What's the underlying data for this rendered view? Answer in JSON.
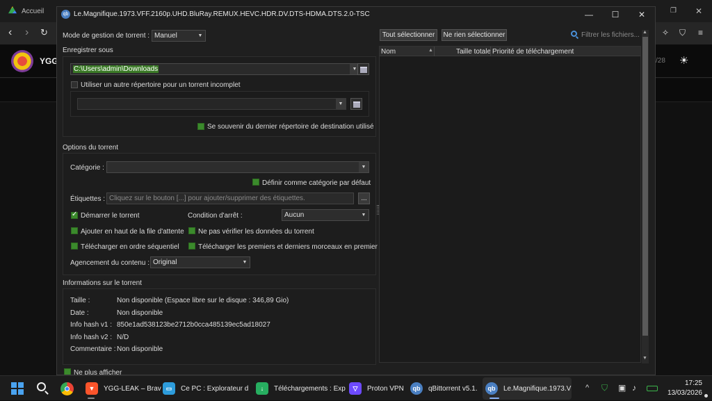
{
  "browser": {
    "tab_title": "Accueil",
    "site_logo_text": "YGG",
    "page_counter": "/28"
  },
  "dialog": {
    "title": "Le.Magnifique.1973.VFF.2160p.UHD.BluRay.REMUX.HEVC.HDR.DV.DTS-HDMA.DTS.2.0-TSC",
    "mode_label": "Mode de gestion de torrent :",
    "mode_value": "Manuel",
    "save_section": "Enregistrer sous",
    "save_path": "C:\\Users\\admin\\Downloads",
    "incomplete_label": "Utiliser un autre répertoire pour un torrent incomplet",
    "remember_label": "Se souvenir du dernier répertoire de destination utilisé",
    "options_section": "Options du torrent",
    "category_label": "Catégorie :",
    "category_value": "",
    "default_category_label": "Définir comme catégorie par défaut",
    "tags_label": "Étiquettes :",
    "tags_placeholder": "Cliquez sur le bouton [...] pour ajouter/supprimer des étiquettes.",
    "tags_button": "...",
    "start_label": "Démarrer le torrent",
    "stop_condition_label": "Condition d'arrêt :",
    "stop_condition_value": "Aucun",
    "add_top_label": "Ajouter en haut de la file d'attente",
    "skip_check_label": "Ne pas vérifier les données du torrent",
    "sequential_label": "Télécharger en ordre séquentiel",
    "first_last_label": "Télécharger les premiers et derniers morceaux en premier",
    "layout_label": "Agencement du contenu :",
    "layout_value": "Original",
    "info_section": "Informations sur le torrent",
    "info": {
      "size_label": "Taille :",
      "size_value": "Non disponible (Espace libre sur le disque : 346,89 Gio)",
      "date_label": "Date :",
      "date_value": "Non disponible",
      "hash1_label": "Info hash v1 :",
      "hash1_value": "850e1ad538123be2712b0cca485139ec5ad18027",
      "hash2_label": "Info hash v2 :",
      "hash2_value": "N/D",
      "comment_label": "Commentaire :",
      "comment_value": "Non disponible"
    },
    "never_show_label": "Ne plus afficher",
    "select_all": "Tout sélectionner",
    "select_none": "Ne rien sélectionner",
    "filter_placeholder": "Filtrer les fichiers...",
    "columns": [
      "Nom",
      "Taille totale",
      "Priorité de téléchargement"
    ]
  },
  "taskbar": {
    "items": [
      {
        "label": "YGG-LEAK – Brav",
        "icon": "brave-icon"
      },
      {
        "label": "Ce PC : Explorateur d",
        "icon": "explorer-icon"
      },
      {
        "label": "Téléchargements : Exp",
        "icon": "downloads-icon"
      },
      {
        "label": "Proton VPN",
        "icon": "protonvpn-icon"
      },
      {
        "label": "qBittorrent v5.1.",
        "icon": "qbittorrent-icon"
      },
      {
        "label": "Le.Magnifique.1973.V",
        "icon": "qbittorrent-icon"
      }
    ],
    "time": "17:25",
    "date": "13/03/2026"
  },
  "colors": {
    "accent": "#3b8a2c",
    "taskbar_underline": "#8ab4f8"
  }
}
